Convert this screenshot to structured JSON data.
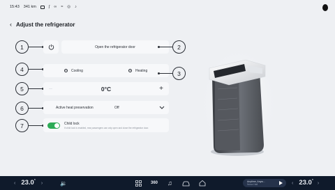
{
  "status_bar": {
    "time": "15:43",
    "range": "341 km",
    "icons": [
      "battery-icon",
      "signal-icon",
      "bluetooth-icon",
      "wifi-icon",
      "location-icon",
      "bell-icon"
    ]
  },
  "header": {
    "title": "Adjust the refrigerator"
  },
  "rows": {
    "power": {
      "marker": "1",
      "label": "Open the refrigerator door",
      "marker_right": "2"
    },
    "mode": {
      "marker": "4",
      "option_cooling": "Cooling",
      "option_heating": "Heating",
      "selected": "Heating",
      "marker_right": "3"
    },
    "temperature": {
      "marker": "5",
      "value": "0°C",
      "minus": "—",
      "plus": "+"
    },
    "heat": {
      "marker": "6",
      "label": "Active heat preservation",
      "value": "Off"
    },
    "child_lock": {
      "marker": "7",
      "label": "Child lock",
      "description": "If child lock is enabled, rear passengers can only open and close the refrigerator door.",
      "enabled": true
    }
  },
  "bottom_bar": {
    "left_temp": "23.0",
    "right_temp": "23.0",
    "temp_unit": "°",
    "media_title": "Anytime, Anyw...",
    "media_subtitle": "Nova Hall"
  }
}
